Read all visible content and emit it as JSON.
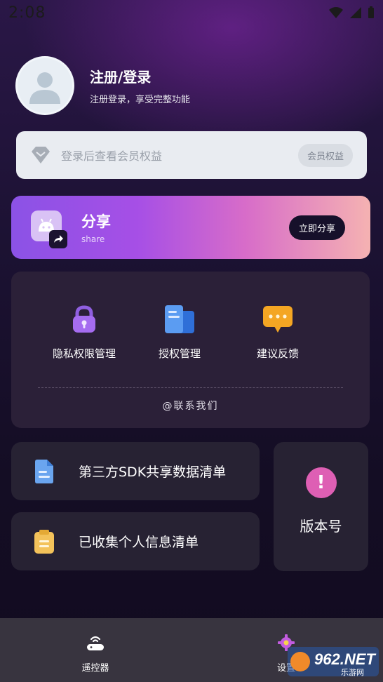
{
  "status_bar": {
    "time": "2:08"
  },
  "profile": {
    "title": "注册/登录",
    "subtitle": "注册登录，享受完整功能"
  },
  "member": {
    "text": "登录后查看会员权益",
    "button_label": "会员权益"
  },
  "share": {
    "title": "分享",
    "subtitle": "share",
    "button_label": "立即分享"
  },
  "tools": {
    "items": [
      {
        "label": "隐私权限管理",
        "icon": "lock-icon"
      },
      {
        "label": "授权管理",
        "icon": "documents-icon"
      },
      {
        "label": "建议反馈",
        "icon": "chat-bubble-icon"
      }
    ],
    "contact": "@联系我们"
  },
  "cards": {
    "sdk_list": "第三方SDK共享数据清单",
    "personal_info": "已收集个人信息清单",
    "version": "版本号"
  },
  "bottom_nav": {
    "items": [
      {
        "label": "遥控器",
        "icon": "remote-router-icon"
      },
      {
        "label": "设置",
        "icon": "gear-icon"
      }
    ]
  },
  "watermark": {
    "brand": "962.NET",
    "sub": "乐游网"
  },
  "colors": {
    "accent_purple": "#8b52e6",
    "share_gradient_end": "#f5b2b2",
    "card_bg": "#272233",
    "nav_bg": "#38343f",
    "version_icon": "#de5fb4"
  }
}
